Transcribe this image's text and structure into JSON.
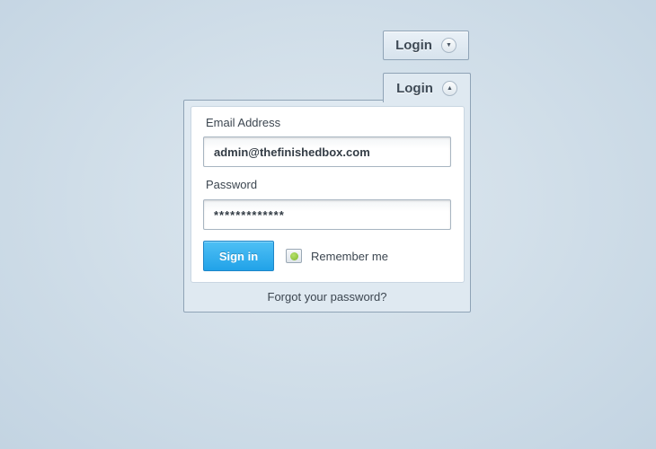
{
  "collapsed_login": {
    "label": "Login",
    "toggle_symbol": "▼",
    "toggle_icon": "chevron-down-icon"
  },
  "expanded_login": {
    "label": "Login",
    "toggle_symbol": "▲",
    "toggle_icon": "chevron-up-icon"
  },
  "form": {
    "email_label": "Email Address",
    "email_value": "admin@thefinishedbox.com",
    "password_label": "Password",
    "password_value": "*************",
    "sign_in_label": "Sign in",
    "remember_label": "Remember me",
    "remember_checked": true,
    "forgot_link": "Forgot your password?"
  },
  "colors": {
    "primary_button": "#21a2e8",
    "checkbox_dot": "#7fb92e",
    "border": "#8fa3b6"
  }
}
